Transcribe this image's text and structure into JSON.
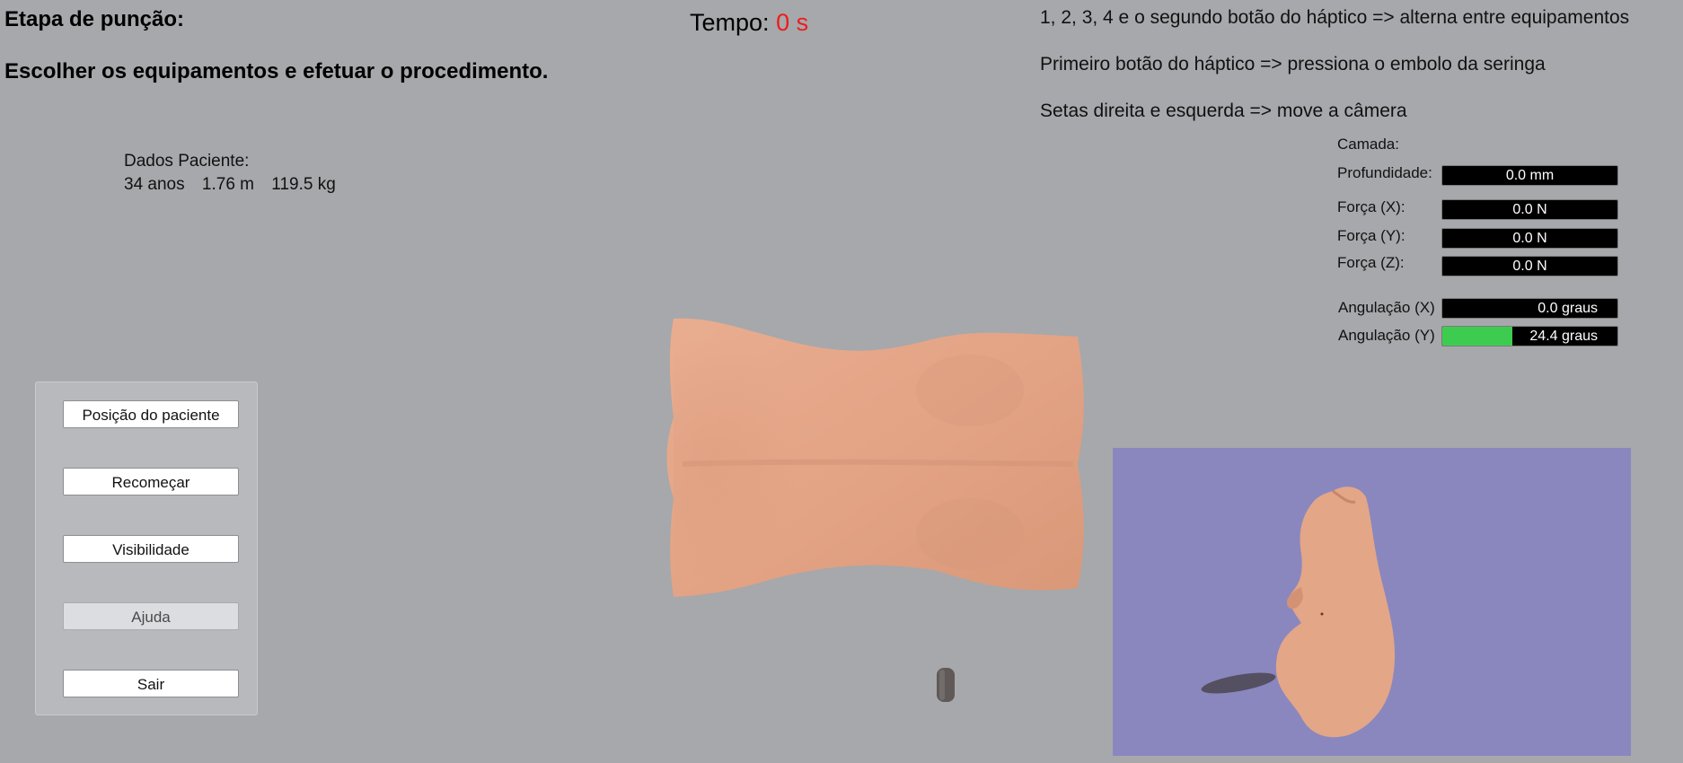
{
  "header": {
    "stage_title": "Etapa de punção:",
    "instruction": "Escolher os equipamentos e efetuar o procedimento.",
    "timer_label": "Tempo:",
    "timer_value": "0 s",
    "timer_color": "#ee1c1c"
  },
  "help_lines": [
    "1, 2, 3, 4 e o segundo botão do háptico => alterna entre equipamentos",
    "Primeiro botão do háptico => pressiona o embolo da seringa",
    "Setas direita e esquerda => move a câmera"
  ],
  "patient": {
    "heading": "Dados Paciente:",
    "age": "34 anos",
    "height": "1.76 m",
    "weight": "119.5 kg"
  },
  "menu": {
    "buttons": [
      {
        "label": "Posição do paciente",
        "enabled": true
      },
      {
        "label": "Recomeçar",
        "enabled": true
      },
      {
        "label": "Visibilidade",
        "enabled": true
      },
      {
        "label": "Ajuda",
        "enabled": false
      },
      {
        "label": "Sair",
        "enabled": true
      }
    ]
  },
  "readouts": {
    "camada_label": "Camada:",
    "profundidade": {
      "label": "Profundidade:",
      "value": "0.0 mm"
    },
    "forca_x": {
      "label": "Força (X):",
      "value": "0.0 N"
    },
    "forca_y": {
      "label": "Força (Y):",
      "value": "0.0 N"
    },
    "forca_z": {
      "label": "Força (Z):",
      "value": "0.0 N"
    },
    "angulacao_x": {
      "label": "Angulação (X)",
      "value": "0.0 graus",
      "fill_fraction": 0
    },
    "angulacao_y": {
      "label": "Angulação (Y)",
      "value": "24.4 graus",
      "fill_fraction": 0.4
    },
    "fill_color": "#3ecc50"
  },
  "scene": {
    "skin_color": "#e7a98b",
    "minimap_bg": "#8a87bf",
    "background": "#a6a8ab"
  }
}
